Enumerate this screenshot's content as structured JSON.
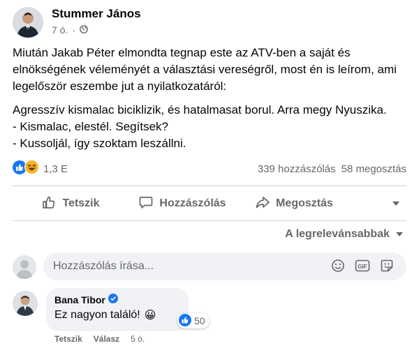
{
  "post": {
    "author": "Stummer János",
    "time": "7 ó.",
    "privacy_icon": "globe-icon",
    "paragraph1": "Miután Jakab Péter elmondta tegnap este az ATV-ben a saját és elnökségének véleményét a választási vereségről, most én is leírom, ami legelőször eszembe jut a nyilatkozatáról:",
    "line1": "Agresszív kismalac biciklizik, és hatalmasat borul. Arra megy Nyuszika.",
    "line2": "- Kismalac, elestél. Segítsek?",
    "line3": "- Kussoljál, így szoktam leszállni."
  },
  "reactions": {
    "icons": [
      "like-icon",
      "haha-icon"
    ],
    "count": "1,3 E",
    "comments": "339 hozzászólás",
    "shares": "58 megosztás"
  },
  "actions": {
    "like": "Tetszik",
    "comment": "Hozzászólás",
    "share": "Megosztás"
  },
  "sort": {
    "label": "A legrelevánsabbak"
  },
  "composer": {
    "placeholder": "Hozzászólás írása..."
  },
  "comment": {
    "author": "Bana Tibor",
    "verified": true,
    "text": "Ez nagyon találó!",
    "emoji": "😀",
    "like_count": "50",
    "like": "Tetszik",
    "reply": "Válasz",
    "time": "5 ó."
  },
  "colors": {
    "like_blue": "#1877f2",
    "haha_yellow": "#f7b125",
    "secondary_text": "#65676b"
  }
}
